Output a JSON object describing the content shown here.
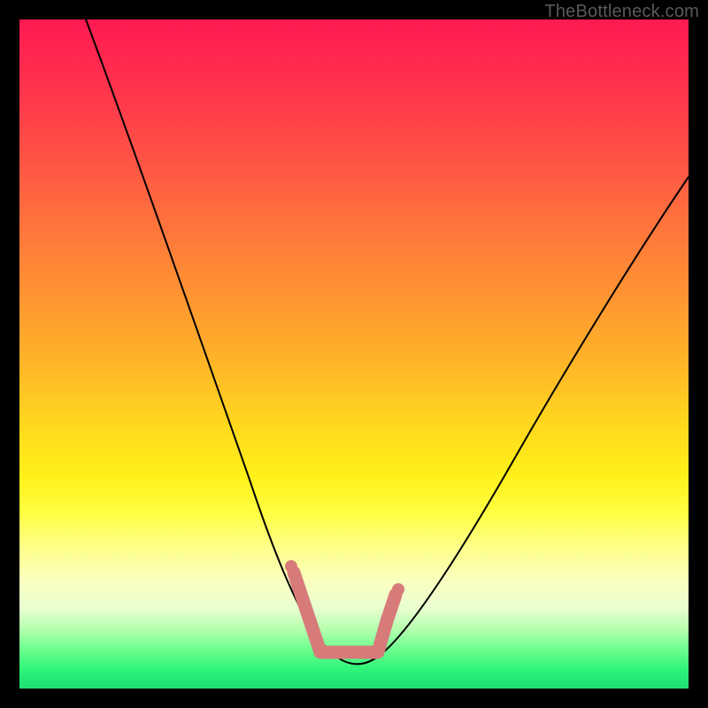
{
  "watermark": "TheBottleneck.com",
  "colors": {
    "frame_bg_top": "#ff1a52",
    "frame_bg_bottom": "#1ee072",
    "curve_stroke": "#000000",
    "marker_stroke": "#d77a7a",
    "page_bg": "#000000",
    "watermark_text": "#5a5a5a"
  },
  "chart_data": {
    "type": "line",
    "title": "",
    "xlabel": "",
    "ylabel": "",
    "xlim": [
      0,
      100
    ],
    "ylim": [
      0,
      100
    ],
    "grid": false,
    "legend": false,
    "series": [
      {
        "name": "bottleneck-curve",
        "x": [
          10,
          14,
          18,
          22,
          26,
          30,
          34,
          38,
          41,
          44,
          46,
          48,
          50,
          52,
          55,
          60,
          66,
          72,
          78,
          85,
          92,
          100
        ],
        "values": [
          100,
          88,
          76,
          65,
          55,
          45,
          36,
          27,
          18,
          11,
          6,
          3,
          2,
          3,
          6,
          12,
          20,
          30,
          40,
          52,
          64,
          77
        ]
      }
    ],
    "annotations": [
      {
        "name": "optimal-marker",
        "shape": "rounded-L",
        "x_range": [
          41,
          55
        ],
        "y_range": [
          2,
          18
        ]
      }
    ]
  }
}
